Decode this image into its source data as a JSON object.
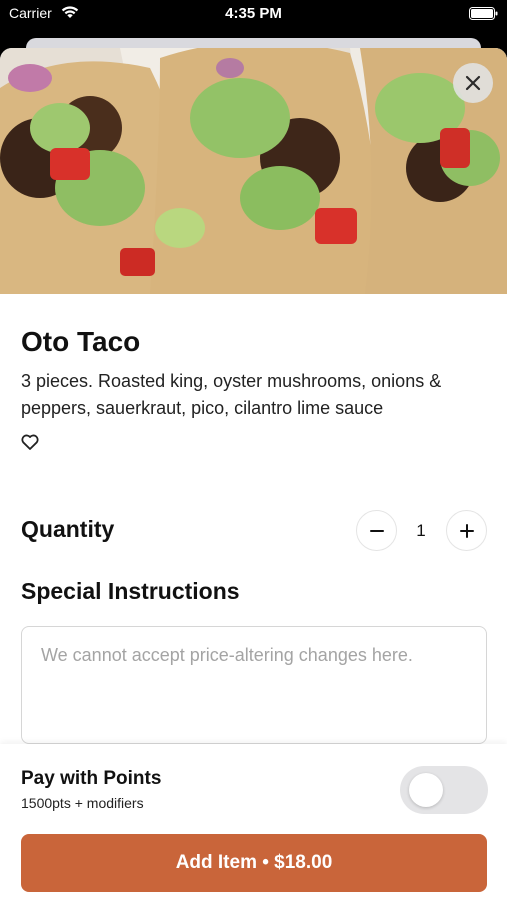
{
  "status_bar": {
    "carrier": "Carrier",
    "time": "4:35 PM"
  },
  "item": {
    "title": "Oto Taco",
    "description": "3 pieces. Roasted king, oyster mushrooms, onions & peppers, sauerkraut, pico, cilantro lime sauce",
    "hero_image": "tacos-photo"
  },
  "quantity": {
    "label": "Quantity",
    "value": "1"
  },
  "instructions": {
    "label": "Special Instructions",
    "value": "",
    "placeholder": "We cannot accept price-altering changes here."
  },
  "points": {
    "title": "Pay with Points",
    "subtitle": "1500pts + modifiers",
    "enabled": false
  },
  "cta": {
    "label": "Add Item • $18.00"
  },
  "colors": {
    "accent": "#c9653a",
    "toggle_off": "#e4e4e6"
  }
}
